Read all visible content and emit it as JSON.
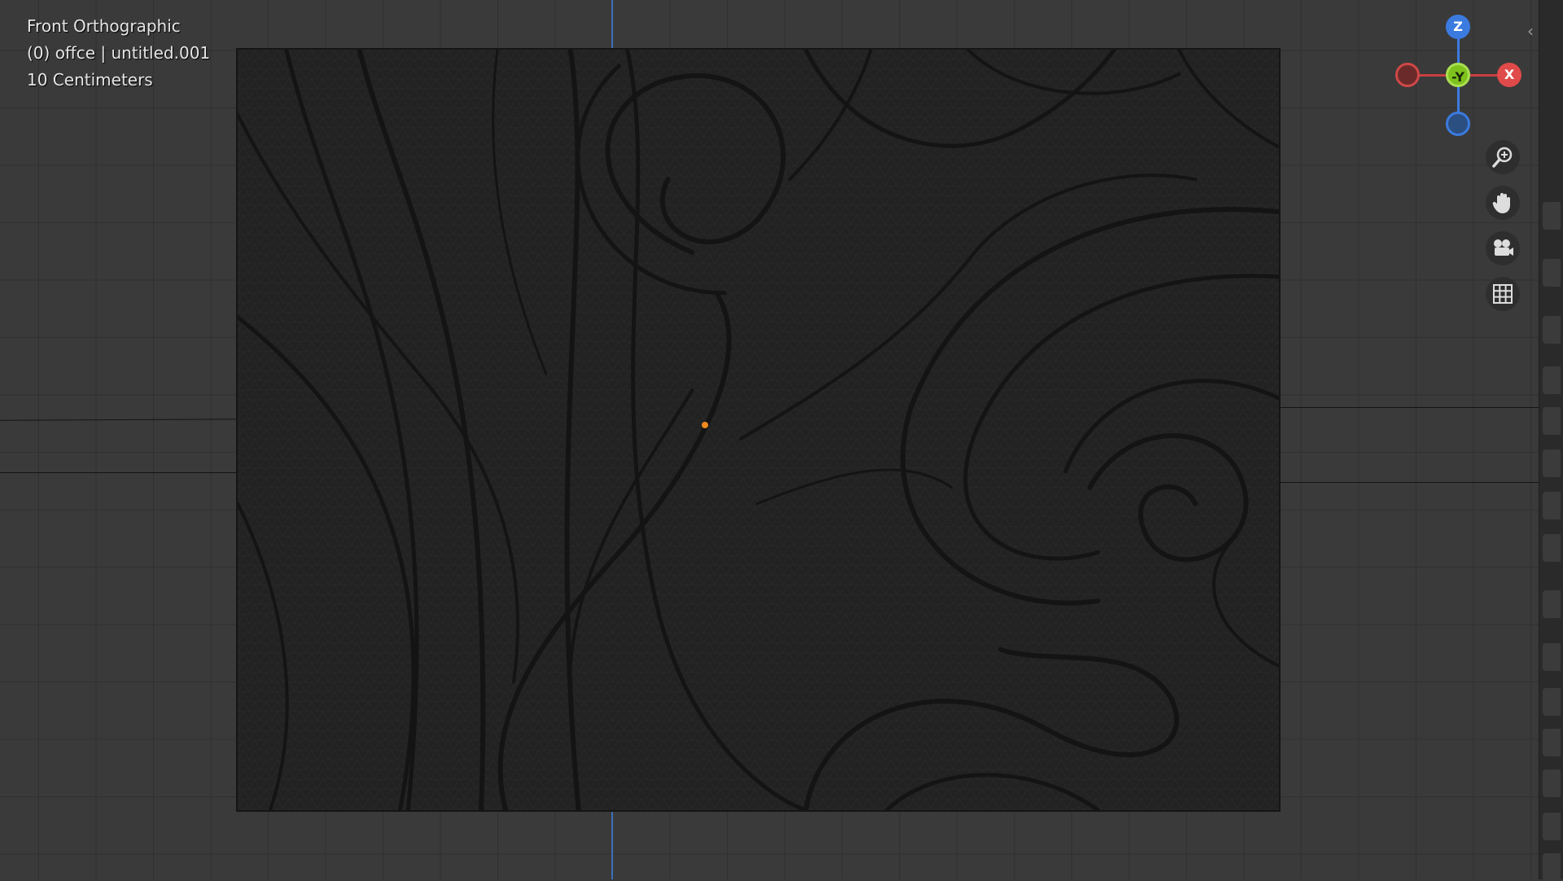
{
  "viewport": {
    "view_name": "Front Orthographic",
    "object_info": "(0) offce | untitled.001",
    "scale_info": "10 Centimeters"
  },
  "gizmo": {
    "z_label": "Z",
    "y_label": "-Y",
    "x_label": "X",
    "colors": {
      "z": "#3b7be0",
      "y": "#7fc21e",
      "x": "#e04a4a"
    }
  },
  "nav_buttons": [
    {
      "name": "zoom-icon"
    },
    {
      "name": "hand-pan-icon"
    },
    {
      "name": "camera-icon"
    },
    {
      "name": "grid-ortho-icon"
    }
  ],
  "colors": {
    "background": "#3a3a3a",
    "mesh": "#202020",
    "origin": "#f08a1c",
    "z_axis": "#3e6fb8"
  }
}
